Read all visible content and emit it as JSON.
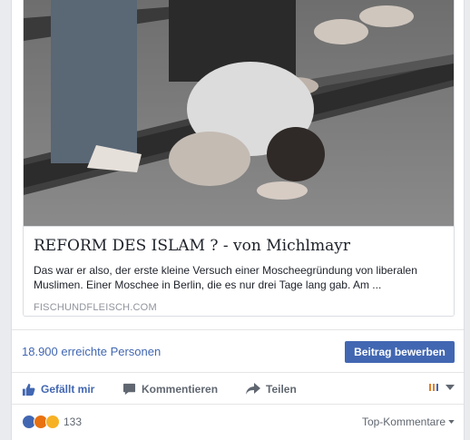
{
  "link": {
    "title": "REFORM DES ISLAM ? - von Michlmayr",
    "description": "Das war er also, der erste kleine Versuch einer Moscheegründung von liberalen Muslimen. Einer Moschee in Berlin, die es nur drei Tage lang gab. Am ...",
    "domain": "FISCHUNDFLEISCH.COM",
    "image_icon": "photo-child-praying-in-mosque"
  },
  "reach": {
    "text": "18.900 erreichte Personen",
    "boost_label": "Beitrag bewerben"
  },
  "actions": {
    "like": "Gefällt mir",
    "comment": "Kommentieren",
    "share": "Teilen"
  },
  "reactions": {
    "count": "133",
    "filter": "Top-Kommentare"
  },
  "colors": {
    "accent": "#4267b2",
    "background": "#e9ebee"
  }
}
